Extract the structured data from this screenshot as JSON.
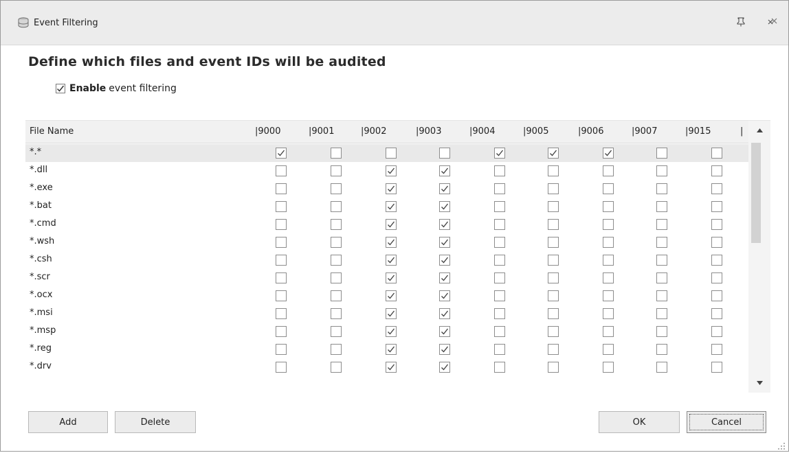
{
  "window": {
    "title": "Event Filtering",
    "icon": "database-icon",
    "controls": [
      "pin-icon",
      "restore-icon"
    ]
  },
  "heading": "Define which files and event IDs will be audited",
  "enable": {
    "bold_label": "Enable",
    "label": "event filtering",
    "checked": true
  },
  "grid": {
    "name_header": "File Name",
    "columns": [
      "|9000",
      "|9001",
      "|9002",
      "|9003",
      "|9004",
      "|9005",
      "|9006",
      "|9007",
      "|9015",
      "|"
    ],
    "rows": [
      {
        "name": "*.*",
        "checks": [
          true,
          false,
          false,
          false,
          true,
          true,
          true,
          false,
          false
        ],
        "selected": true
      },
      {
        "name": "*.dll",
        "checks": [
          false,
          false,
          true,
          true,
          false,
          false,
          false,
          false,
          false
        ]
      },
      {
        "name": "*.exe",
        "checks": [
          false,
          false,
          true,
          true,
          false,
          false,
          false,
          false,
          false
        ]
      },
      {
        "name": "*.bat",
        "checks": [
          false,
          false,
          true,
          true,
          false,
          false,
          false,
          false,
          false
        ]
      },
      {
        "name": "*.cmd",
        "checks": [
          false,
          false,
          true,
          true,
          false,
          false,
          false,
          false,
          false
        ]
      },
      {
        "name": "*.wsh",
        "checks": [
          false,
          false,
          true,
          true,
          false,
          false,
          false,
          false,
          false
        ]
      },
      {
        "name": "*.csh",
        "checks": [
          false,
          false,
          true,
          true,
          false,
          false,
          false,
          false,
          false
        ]
      },
      {
        "name": "*.scr",
        "checks": [
          false,
          false,
          true,
          true,
          false,
          false,
          false,
          false,
          false
        ]
      },
      {
        "name": "*.ocx",
        "checks": [
          false,
          false,
          true,
          true,
          false,
          false,
          false,
          false,
          false
        ]
      },
      {
        "name": "*.msi",
        "checks": [
          false,
          false,
          true,
          true,
          false,
          false,
          false,
          false,
          false
        ]
      },
      {
        "name": "*.msp",
        "checks": [
          false,
          false,
          true,
          true,
          false,
          false,
          false,
          false,
          false
        ]
      },
      {
        "name": "*.reg",
        "checks": [
          false,
          false,
          true,
          true,
          false,
          false,
          false,
          false,
          false
        ]
      },
      {
        "name": "*.drv",
        "checks": [
          false,
          false,
          true,
          true,
          false,
          false,
          false,
          false,
          false
        ]
      }
    ]
  },
  "buttons": {
    "add": "Add",
    "delete": "Delete",
    "ok": "OK",
    "cancel": "Cancel"
  }
}
